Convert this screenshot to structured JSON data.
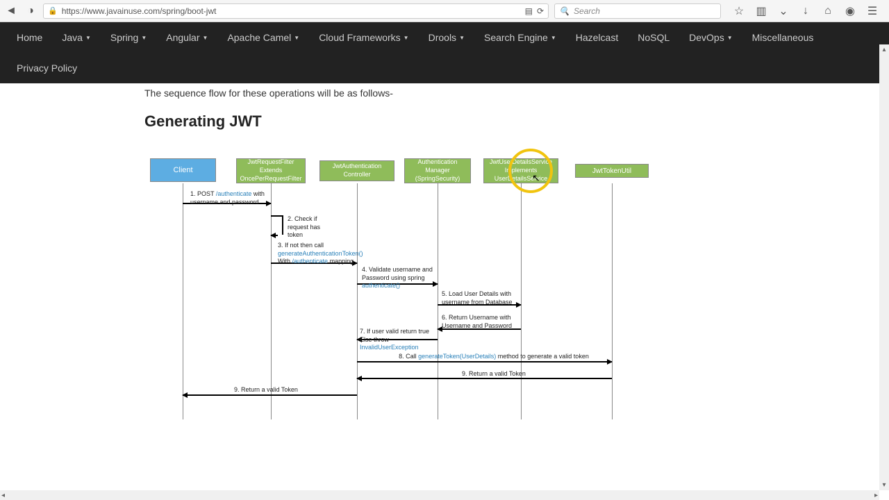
{
  "browser": {
    "url": "https://www.javainuse.com/spring/boot-jwt",
    "search_placeholder": "Search"
  },
  "nav": {
    "items": [
      "Home",
      "Java",
      "Spring",
      "Angular",
      "Apache Camel",
      "Cloud Frameworks",
      "Drools",
      "Search Engine",
      "Hazelcast",
      "NoSQL",
      "DevOps",
      "Miscellaneous",
      "Privacy Policy"
    ],
    "dropdown_flags": [
      false,
      true,
      true,
      true,
      true,
      true,
      true,
      true,
      false,
      false,
      true,
      false,
      false
    ]
  },
  "content": {
    "intro": "The sequence flow for these operations will be as follows-",
    "heading": "Generating JWT"
  },
  "diagram": {
    "boxes": {
      "client": "Client",
      "b1_l1": "JwtRequestFilter",
      "b1_l2": "Extends",
      "b1_l3": "OncePerRequestFilter",
      "b2_l1": "JwtAuthentication",
      "b2_l2": "Controller",
      "b3_l1": "Authentication",
      "b3_l2": "Manager",
      "b3_l3": "(SpringSecurity)",
      "b4_l1": "JwtUserDetailsService",
      "b4_l2": "Implements",
      "b4_l3": "UserDetailsService",
      "b5": "JwtTokenUtil"
    },
    "labels": {
      "l1_pre": "1.   POST ",
      "l1_link": "/authenticate",
      "l1_post": " with username and password",
      "l2": "2. Check if request has token",
      "l3_pre": "3. If not then call ",
      "l3_link": "generateAuthenticationToken()",
      "l3_post_pre": " With ",
      "l3_post_link": "/authenticate",
      "l3_post_post": " mapping",
      "l4_pre": "4. Validate username and Password using spring ",
      "l4_link": "authenticate()",
      "l5": "5.  Load User Details with username from  Database",
      "l6": "6.   Return Username with Username and Password",
      "l7_pre": "7. If user valid return true Else throw ",
      "l7_link": "InvalidUserException",
      "l8_pre": "8. Call ",
      "l8_link": "generateToken(UserDetails)",
      "l8_post": " method to generate a valid token",
      "l9": "9. Return a valid Token",
      "l10": "9. Return a valid Token"
    }
  }
}
